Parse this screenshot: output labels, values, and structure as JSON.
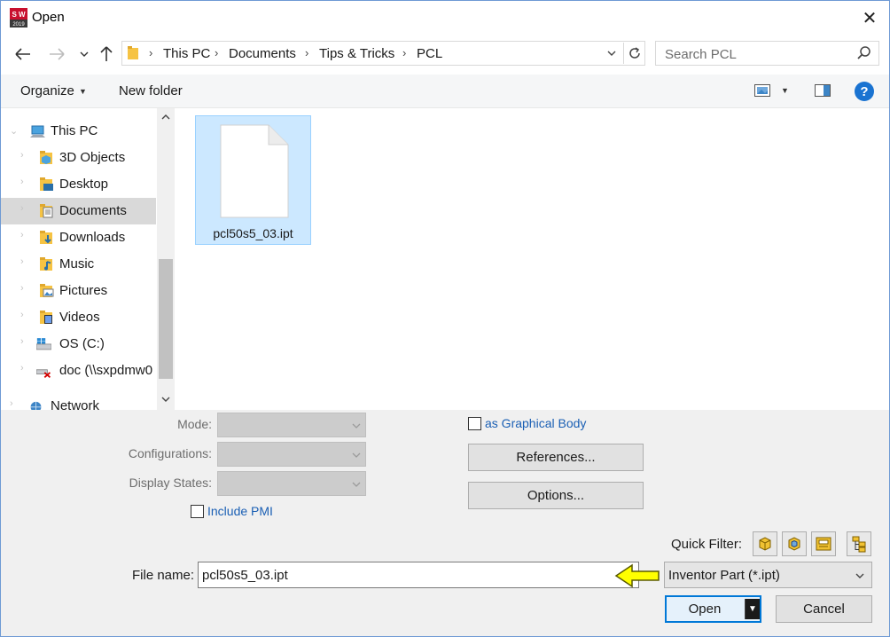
{
  "window": {
    "title": "Open",
    "app_icon_text": "SW 2019"
  },
  "address": {
    "breadcrumbs": [
      "This PC",
      "Documents",
      "Tips & Tricks",
      "PCL"
    ]
  },
  "search": {
    "placeholder": "Search PCL"
  },
  "toolbar": {
    "organize_label": "Organize",
    "new_folder_label": "New folder"
  },
  "nav_tree": [
    {
      "label": "This PC",
      "icon": "computer-icon",
      "level": 0,
      "expanded": true
    },
    {
      "label": "3D Objects",
      "icon": "3d-objects-icon",
      "level": 1
    },
    {
      "label": "Desktop",
      "icon": "desktop-folder-icon",
      "level": 1
    },
    {
      "label": "Documents",
      "icon": "documents-folder-icon",
      "level": 1,
      "selected": true
    },
    {
      "label": "Downloads",
      "icon": "downloads-folder-icon",
      "level": 1
    },
    {
      "label": "Music",
      "icon": "music-folder-icon",
      "level": 1
    },
    {
      "label": "Pictures",
      "icon": "pictures-folder-icon",
      "level": 1
    },
    {
      "label": "Videos",
      "icon": "videos-folder-icon",
      "level": 1
    },
    {
      "label": "OS (C:)",
      "icon": "drive-icon",
      "level": 1
    },
    {
      "label": "doc (\\\\sxpdmw0",
      "icon": "network-drive-icon",
      "level": 1
    },
    {
      "label": "Network",
      "icon": "network-icon",
      "level": 0
    }
  ],
  "files": [
    {
      "name": "pcl50s5_03.ipt",
      "selected": true
    }
  ],
  "options": {
    "mode_label": "Mode:",
    "configurations_label": "Configurations:",
    "display_states_label": "Display States:",
    "include_pmi_label": "Include PMI",
    "graphical_body_label": "as Graphical Body",
    "references_button": "References...",
    "options_button": "Options...",
    "quick_filter_label": "Quick Filter:"
  },
  "file_name": {
    "label": "File name:",
    "value": "pcl50s5_03.ipt"
  },
  "file_type": {
    "value": "Inventor Part (*.ipt)"
  },
  "actions": {
    "open_label": "Open",
    "cancel_label": "Cancel"
  },
  "colors": {
    "accent": "#0078d7",
    "selection_bg": "#cce8ff",
    "link_text": "#1a5fb4",
    "arrow_yellow": "#ffff00"
  }
}
